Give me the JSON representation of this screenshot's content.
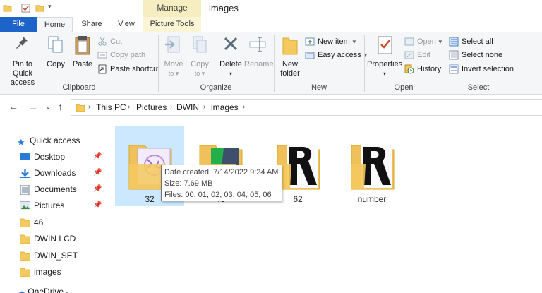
{
  "titlebar": {
    "contextual_tab": "Manage",
    "window_title": "images"
  },
  "tabs": {
    "file": "File",
    "home": "Home",
    "share": "Share",
    "view": "View",
    "picture_tools": "Picture Tools"
  },
  "ribbon": {
    "clipboard": {
      "label": "Clipboard",
      "pin_line1": "Pin to Quick",
      "pin_line2": "access",
      "copy": "Copy",
      "paste": "Paste",
      "cut": "Cut",
      "copy_path": "Copy path",
      "paste_shortcut": "Paste shortcut"
    },
    "organize": {
      "label": "Organize",
      "move_to": "Move",
      "move_to_sub": "to",
      "copy_to": "Copy",
      "copy_to_sub": "to",
      "delete": "Delete",
      "rename": "Rename"
    },
    "new": {
      "label": "New",
      "new_folder_line1": "New",
      "new_folder_line2": "folder",
      "new_item": "New item",
      "easy_access": "Easy access"
    },
    "open": {
      "label": "Open",
      "properties": "Properties",
      "open": "Open",
      "edit": "Edit",
      "history": "History"
    },
    "select": {
      "label": "Select",
      "select_all": "Select all",
      "select_none": "Select none",
      "invert_selection": "Invert selection"
    }
  },
  "address": {
    "crumbs": [
      "This PC",
      "Pictures",
      "DWIN",
      "images"
    ]
  },
  "navpane": {
    "quick_access": "Quick access",
    "items": [
      {
        "label": "Desktop",
        "icon": "desktop-icon",
        "pinned": true
      },
      {
        "label": "Downloads",
        "icon": "downloads-icon",
        "pinned": true
      },
      {
        "label": "Documents",
        "icon": "documents-icon",
        "pinned": true
      },
      {
        "label": "Pictures",
        "icon": "pictures-icon",
        "pinned": true
      },
      {
        "label": "46",
        "icon": "folder-icon",
        "pinned": false
      },
      {
        "label": "DWIN LCD",
        "icon": "folder-icon",
        "pinned": false
      },
      {
        "label": "DWIN_SET",
        "icon": "folder-icon",
        "pinned": false
      },
      {
        "label": "images",
        "icon": "folder-icon",
        "pinned": false
      }
    ],
    "partial_item": "OneDrive - Personal"
  },
  "files": [
    {
      "name": "32",
      "selected": true
    },
    {
      "name": "46",
      "selected": false
    },
    {
      "name": "62",
      "selected": false
    },
    {
      "name": "number",
      "selected": false
    }
  ],
  "tooltip": {
    "date_created": "Date created: 7/14/2022 9:24 AM",
    "size": "Size: 7.69 MB",
    "files": "Files: 00, 01, 02, 03, 04, 05, 06"
  },
  "colors": {
    "file_tab": "#1e64c8",
    "manage_tab": "#f6eec0",
    "selection": "#cce8ff",
    "folder": "#f4c95d"
  }
}
